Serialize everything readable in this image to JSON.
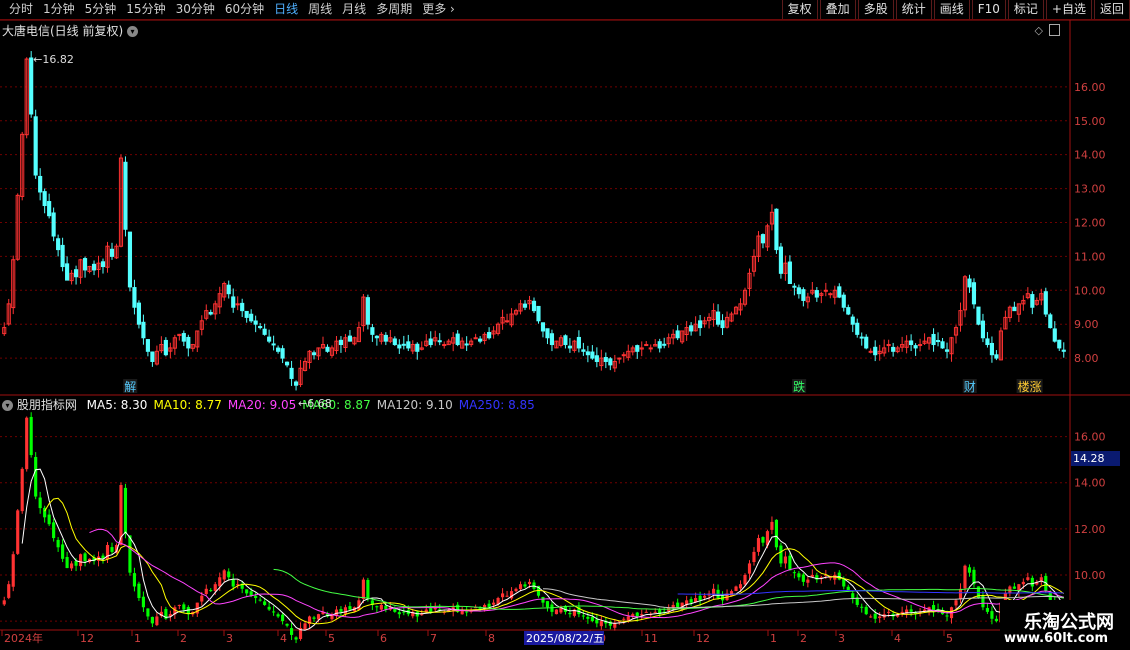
{
  "toolbar": {
    "periods": [
      "分时",
      "1分钟",
      "5分钟",
      "15分钟",
      "30分钟",
      "60分钟",
      "日线",
      "周线",
      "月线",
      "多周期",
      "更多"
    ],
    "active": "日线",
    "right_buttons": [
      "复权",
      "叠加",
      "多股",
      "统计",
      "画线",
      "F10",
      "标记",
      "+自选",
      "返回"
    ]
  },
  "main_title": "大唐电信(日线 前复权)",
  "indicator_title": "股朋指标网",
  "ma_legend": [
    {
      "label": "MA5: 8.30",
      "color": "#ffffff"
    },
    {
      "label": "MA10: 8.77",
      "color": "#ffff00"
    },
    {
      "label": "MA20: 9.05",
      "color": "#ff44ff"
    },
    {
      "label": "MA60: 8.87",
      "color": "#44ff44"
    },
    {
      "label": "MA120: 9.10",
      "color": "#c8c8c8"
    },
    {
      "label": "MA250: 8.85",
      "color": "#3333ff"
    }
  ],
  "watermark": {
    "line1": "乐淘公式网",
    "line2": "www.60lt.com"
  },
  "price_tag": "14.28",
  "chart_data": {
    "type": "candlestick",
    "colors": {
      "up": "#ff3232",
      "down": "#54ffff",
      "up_lower": "#ff3232",
      "down_lower": "#00ff00"
    },
    "main_ylim": [
      7.0,
      17.5
    ],
    "main_yticks": [
      "8.00",
      "9.00",
      "10.00",
      "11.00",
      "12.00",
      "13.00",
      "14.00",
      "15.00",
      "16.00"
    ],
    "lower_ylim": [
      7.7,
      17.5
    ],
    "lower_yticks": [
      "8.00",
      "10.00",
      "12.00",
      "14.00",
      "16.00"
    ],
    "annotations": [
      {
        "text": "16.82",
        "value": 16.82
      },
      {
        "text": "6.68",
        "value": 6.68
      }
    ],
    "event_tags": [
      {
        "text": "解",
        "color": "#55ccff",
        "date_index": 27
      },
      {
        "text": "跌",
        "color": "#33ff66",
        "date_index": 176
      },
      {
        "text": "财",
        "color": "#55ccff",
        "date_index": 214
      },
      {
        "text": "楼涨",
        "color": "#ffcc33",
        "date_index": 226
      }
    ],
    "x_labels": [
      "2024年",
      "12",
      "1",
      "2",
      "3",
      "4",
      "5",
      "6",
      "7",
      "8",
      "9",
      "10",
      "11",
      "12",
      "1",
      "2",
      "3",
      "4",
      "5"
    ],
    "x_highlight": "2025/08/22/五",
    "close_series": [
      8.9,
      9.6,
      10.9,
      12.8,
      14.6,
      16.82,
      15.2,
      13.4,
      12.9,
      12.5,
      12.2,
      11.6,
      11.2,
      10.7,
      10.3,
      10.5,
      10.4,
      10.9,
      10.6,
      10.7,
      10.6,
      10.8,
      10.7,
      11.3,
      11.0,
      11.3,
      13.9,
      11.8,
      10.1,
      9.5,
      9.0,
      8.6,
      8.2,
      7.9,
      8.2,
      8.4,
      8.1,
      8.3,
      8.6,
      8.7,
      8.5,
      8.3,
      8.4,
      8.8,
      9.1,
      9.4,
      9.3,
      9.6,
      9.9,
      10.2,
      9.9,
      9.5,
      9.6,
      9.4,
      9.2,
      9.1,
      9.0,
      8.9,
      8.7,
      8.5,
      8.4,
      8.2,
      8.0,
      7.8,
      7.4,
      7.2,
      7.7,
      7.9,
      8.2,
      8.1,
      8.3,
      8.4,
      8.2,
      8.3,
      8.5,
      8.4,
      8.6,
      8.5,
      8.6,
      8.9,
      9.8,
      9.0,
      8.7,
      8.6,
      8.7,
      8.5,
      8.6,
      8.4,
      8.3,
      8.4,
      8.3,
      8.4,
      8.2,
      8.3,
      8.5,
      8.4,
      8.6,
      8.5,
      8.4,
      8.5,
      8.6,
      8.4,
      8.5,
      8.4,
      8.5,
      8.6,
      8.5,
      8.7,
      8.6,
      8.8,
      9.0,
      9.2,
      9.1,
      9.3,
      9.4,
      9.6,
      9.5,
      9.7,
      9.4,
      9.1,
      8.8,
      8.6,
      8.4,
      8.5,
      8.6,
      8.4,
      8.3,
      8.5,
      8.3,
      8.2,
      8.1,
      8.0,
      7.9,
      8.0,
      7.9,
      7.8,
      7.9,
      8.0,
      8.1,
      8.2,
      8.3,
      8.2,
      8.3,
      8.4,
      8.3,
      8.4,
      8.3,
      8.4,
      8.6,
      8.7,
      8.6,
      8.8,
      8.9,
      8.8,
      9.0,
      8.9,
      9.1,
      9.2,
      9.4,
      9.0,
      8.9,
      9.2,
      9.3,
      9.5,
      9.6,
      10.0,
      10.5,
      11.0,
      11.6,
      11.4,
      11.9,
      12.3,
      11.2,
      10.5,
      10.8,
      10.2,
      10.1,
      9.9,
      9.7,
      9.8,
      10.0,
      9.8,
      9.9,
      10.0,
      9.9,
      10.0,
      9.8,
      9.5,
      9.3,
      9.0,
      8.7,
      8.6,
      8.3,
      8.2,
      8.1,
      8.2,
      8.3,
      8.4,
      8.2,
      8.3,
      8.4,
      8.5,
      8.4,
      8.3,
      8.4,
      8.5,
      8.6,
      8.4,
      8.5,
      8.3,
      8.2,
      8.6,
      8.9,
      9.4,
      10.4,
      10.1,
      9.6,
      9.0,
      8.6,
      8.4,
      8.1,
      8.0,
      8.8,
      9.2,
      9.5,
      9.4,
      9.6,
      9.7,
      9.9,
      9.5,
      9.7,
      9.9,
      9.3,
      8.9,
      8.5,
      8.3,
      8.2
    ],
    "x_range_days": 237
  }
}
